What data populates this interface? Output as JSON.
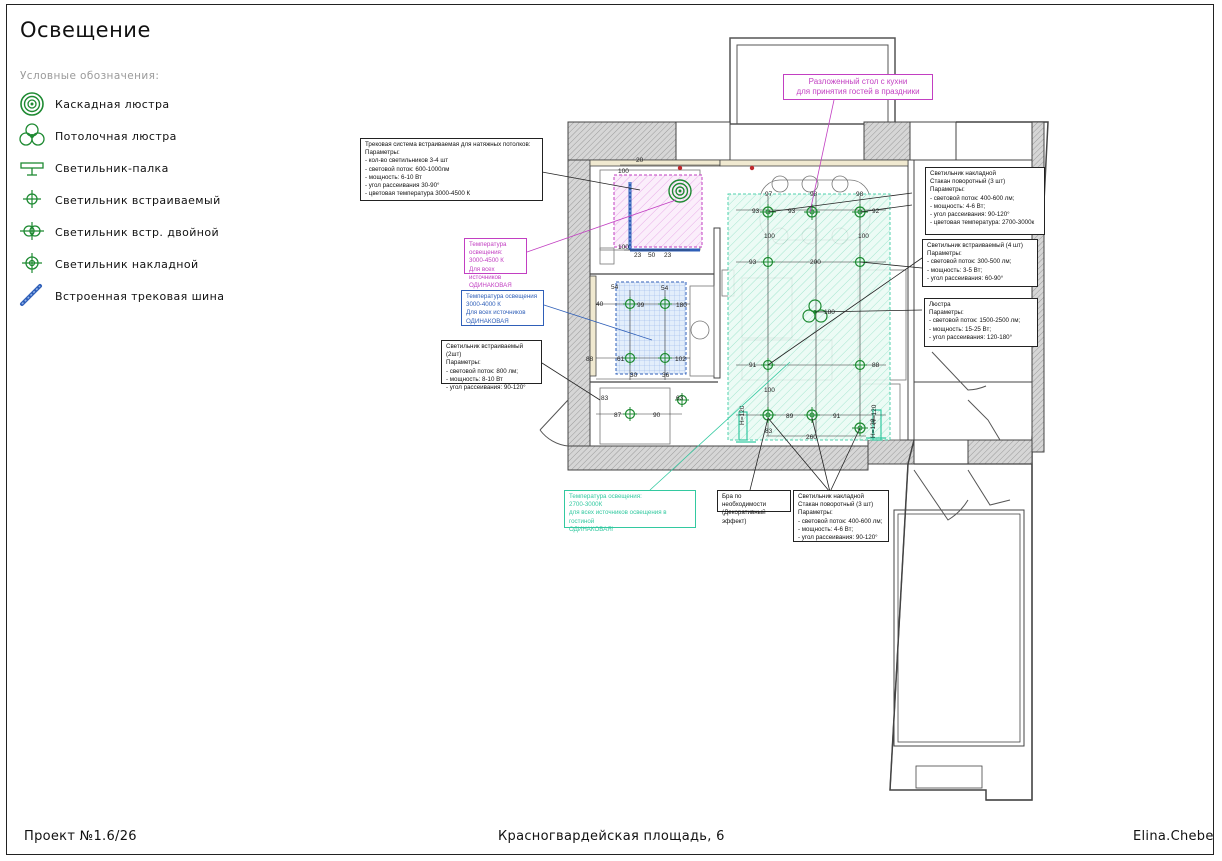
{
  "page": {
    "title": "Освещение",
    "legend_heading": "Условные обозначения:",
    "footer_left": "Проект №1.6/26",
    "footer_center": "Красногвардейская площадь, 6",
    "footer_right": "Elina.Chebe"
  },
  "legend": [
    {
      "icon": "cascade-chandelier-icon",
      "label": "Каскадная люстра"
    },
    {
      "icon": "ceiling-chandelier-icon",
      "label": "Потолочная люстра"
    },
    {
      "icon": "stick-light-icon",
      "label": "Светильник-палка"
    },
    {
      "icon": "recessed-light-icon",
      "label": "Светильник встраиваемый"
    },
    {
      "icon": "double-recessed-light-icon",
      "label": "Светильник встр. двойной"
    },
    {
      "icon": "surface-light-icon",
      "label": "Светильник накладной"
    },
    {
      "icon": "track-rail-icon",
      "label": "Встроенная трековая шина"
    }
  ],
  "colors": {
    "pink": "#c23fc2",
    "blue": "#2f5fb8",
    "teal": "#33c9a0",
    "green": "#1e8a32",
    "wall": "#cfcfcf"
  },
  "callouts": {
    "track": [
      "Трековая система встраиваемая для натяжных потолков:",
      "Параметры:",
      "- кол-во светильников 3-4 шт",
      "- световой поток: 600-1000лм",
      "- мощность: 6-10 Вт",
      "- угол рассеивания 30-90°",
      "- цветовая температура 3000-4500 К"
    ],
    "pink_temp": [
      "Температура освещения:",
      "3000-4500 К",
      "Для всех источников",
      "ОДИНАКОВАЯ"
    ],
    "blue_temp": [
      "Температура освещения",
      "3000-4000 К",
      "Для всех источников",
      "ОДИНАКОВАЯ"
    ],
    "recessed_2": [
      "Светильник встраиваемый (2шт)",
      "Параметры:",
      "- световой поток: 800 лм;",
      "- мощность: 8-10 Вт",
      "- угол рассеивания: 90-120°"
    ],
    "table_note": [
      "Разложенный стол с кухни",
      "для принятия гостей в праздники"
    ],
    "surface_3a": [
      "Светильник накладной",
      "Стакан поворотный (3 шт)",
      "Параметры:",
      "- световой поток: 400-600 лм;",
      "- мощность: 4-6 Вт;",
      "- угол рассеивания: 90-120°",
      "- цветовая температура: 2700-3000к"
    ],
    "recessed_4": [
      "Светильник встраиваемый (4 шт)",
      "Параметры:",
      "- световой поток: 300-500 лм;",
      "- мощность: 3-5 Вт;",
      "- угол рассеивания: 60-90°"
    ],
    "chandelier": [
      "Люстра",
      "Параметры:",
      "- световой поток: 1500-2500 лм;",
      "- мощность: 15-25 Вт;",
      "- угол рассеивания: 120-180°"
    ],
    "teal_temp": [
      "Температура освещения:",
      "2700-3000К",
      "для всех источников освещения в гостиной",
      "ОДИНАКОВАЯ!"
    ],
    "bra": [
      "Бра по необходимости",
      "(Декоративный эффект)"
    ],
    "surface_3b": [
      "Светильник накладной",
      "Стакан поворотный (3 шт)",
      "Параметры:",
      "- световой поток: 400-600 лм;",
      "- мощность: 4-6 Вт;",
      "- угол рассеивания: 90-120°"
    ]
  },
  "dimensions": [
    "20",
    "100",
    "100",
    "23",
    "50",
    "23",
    "54",
    "54",
    "40",
    "99",
    "180",
    "88",
    "61",
    "102",
    "30",
    "36",
    "83",
    "63",
    "87",
    "90",
    "97",
    "98",
    "98",
    "93",
    "93",
    "92",
    "100",
    "100",
    "93",
    "200",
    "180",
    "91",
    "88",
    "100",
    "89",
    "91",
    "83",
    "260",
    "H=120",
    "H=120",
    "H=120"
  ]
}
